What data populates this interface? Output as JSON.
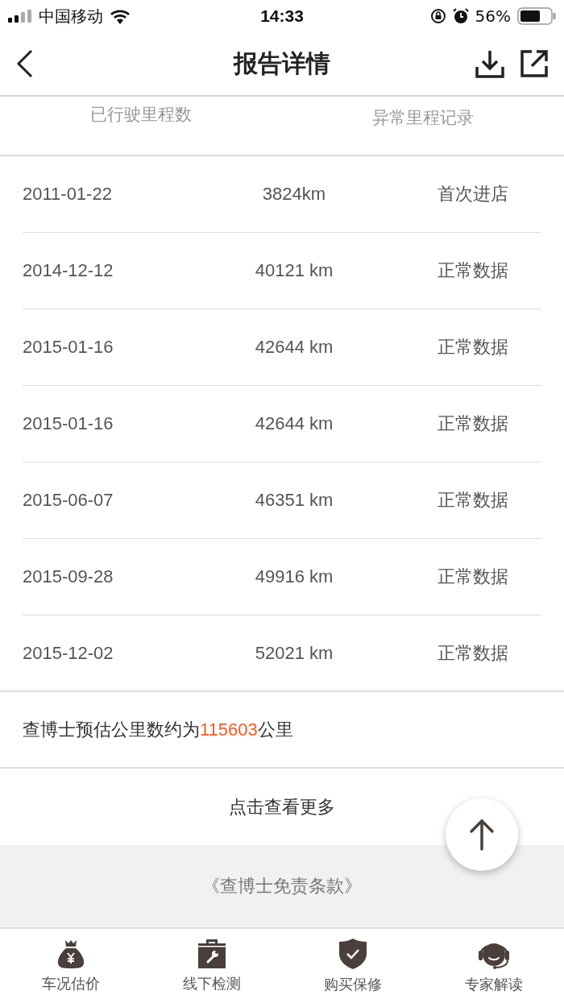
{
  "status_bar": {
    "carrier": "中国移动",
    "time": "14:33",
    "battery": "56%"
  },
  "nav": {
    "title": "报告详情"
  },
  "table": {
    "columns": [
      "已行驶里程数",
      "异常里程记录"
    ],
    "rows": [
      {
        "date": "2011-01-22",
        "mileage": "3824km",
        "status": "首次进店"
      },
      {
        "date": "2014-12-12",
        "mileage": "40121 km",
        "status": "正常数据"
      },
      {
        "date": "2015-01-16",
        "mileage": "42644 km",
        "status": "正常数据"
      },
      {
        "date": "2015-01-16",
        "mileage": "42644 km",
        "status": "正常数据"
      },
      {
        "date": "2015-06-07",
        "mileage": "46351 km",
        "status": "正常数据"
      },
      {
        "date": "2015-09-28",
        "mileage": "49916 km",
        "status": "正常数据"
      },
      {
        "date": "2015-12-02",
        "mileage": "52021 km",
        "status": "正常数据"
      }
    ]
  },
  "estimate": {
    "prefix": "查博士预估公里数约为",
    "value": "115603",
    "suffix": "公里"
  },
  "more_link": "点击查看更多",
  "disclaimer": "《查博士免责条款》",
  "tab_bar": [
    {
      "kind": "moneybag",
      "label": "车况估价"
    },
    {
      "kind": "toolbox",
      "label": "线下检测"
    },
    {
      "kind": "shield",
      "label": "购买保修"
    },
    {
      "kind": "headset",
      "label": "专家解读"
    }
  ]
}
